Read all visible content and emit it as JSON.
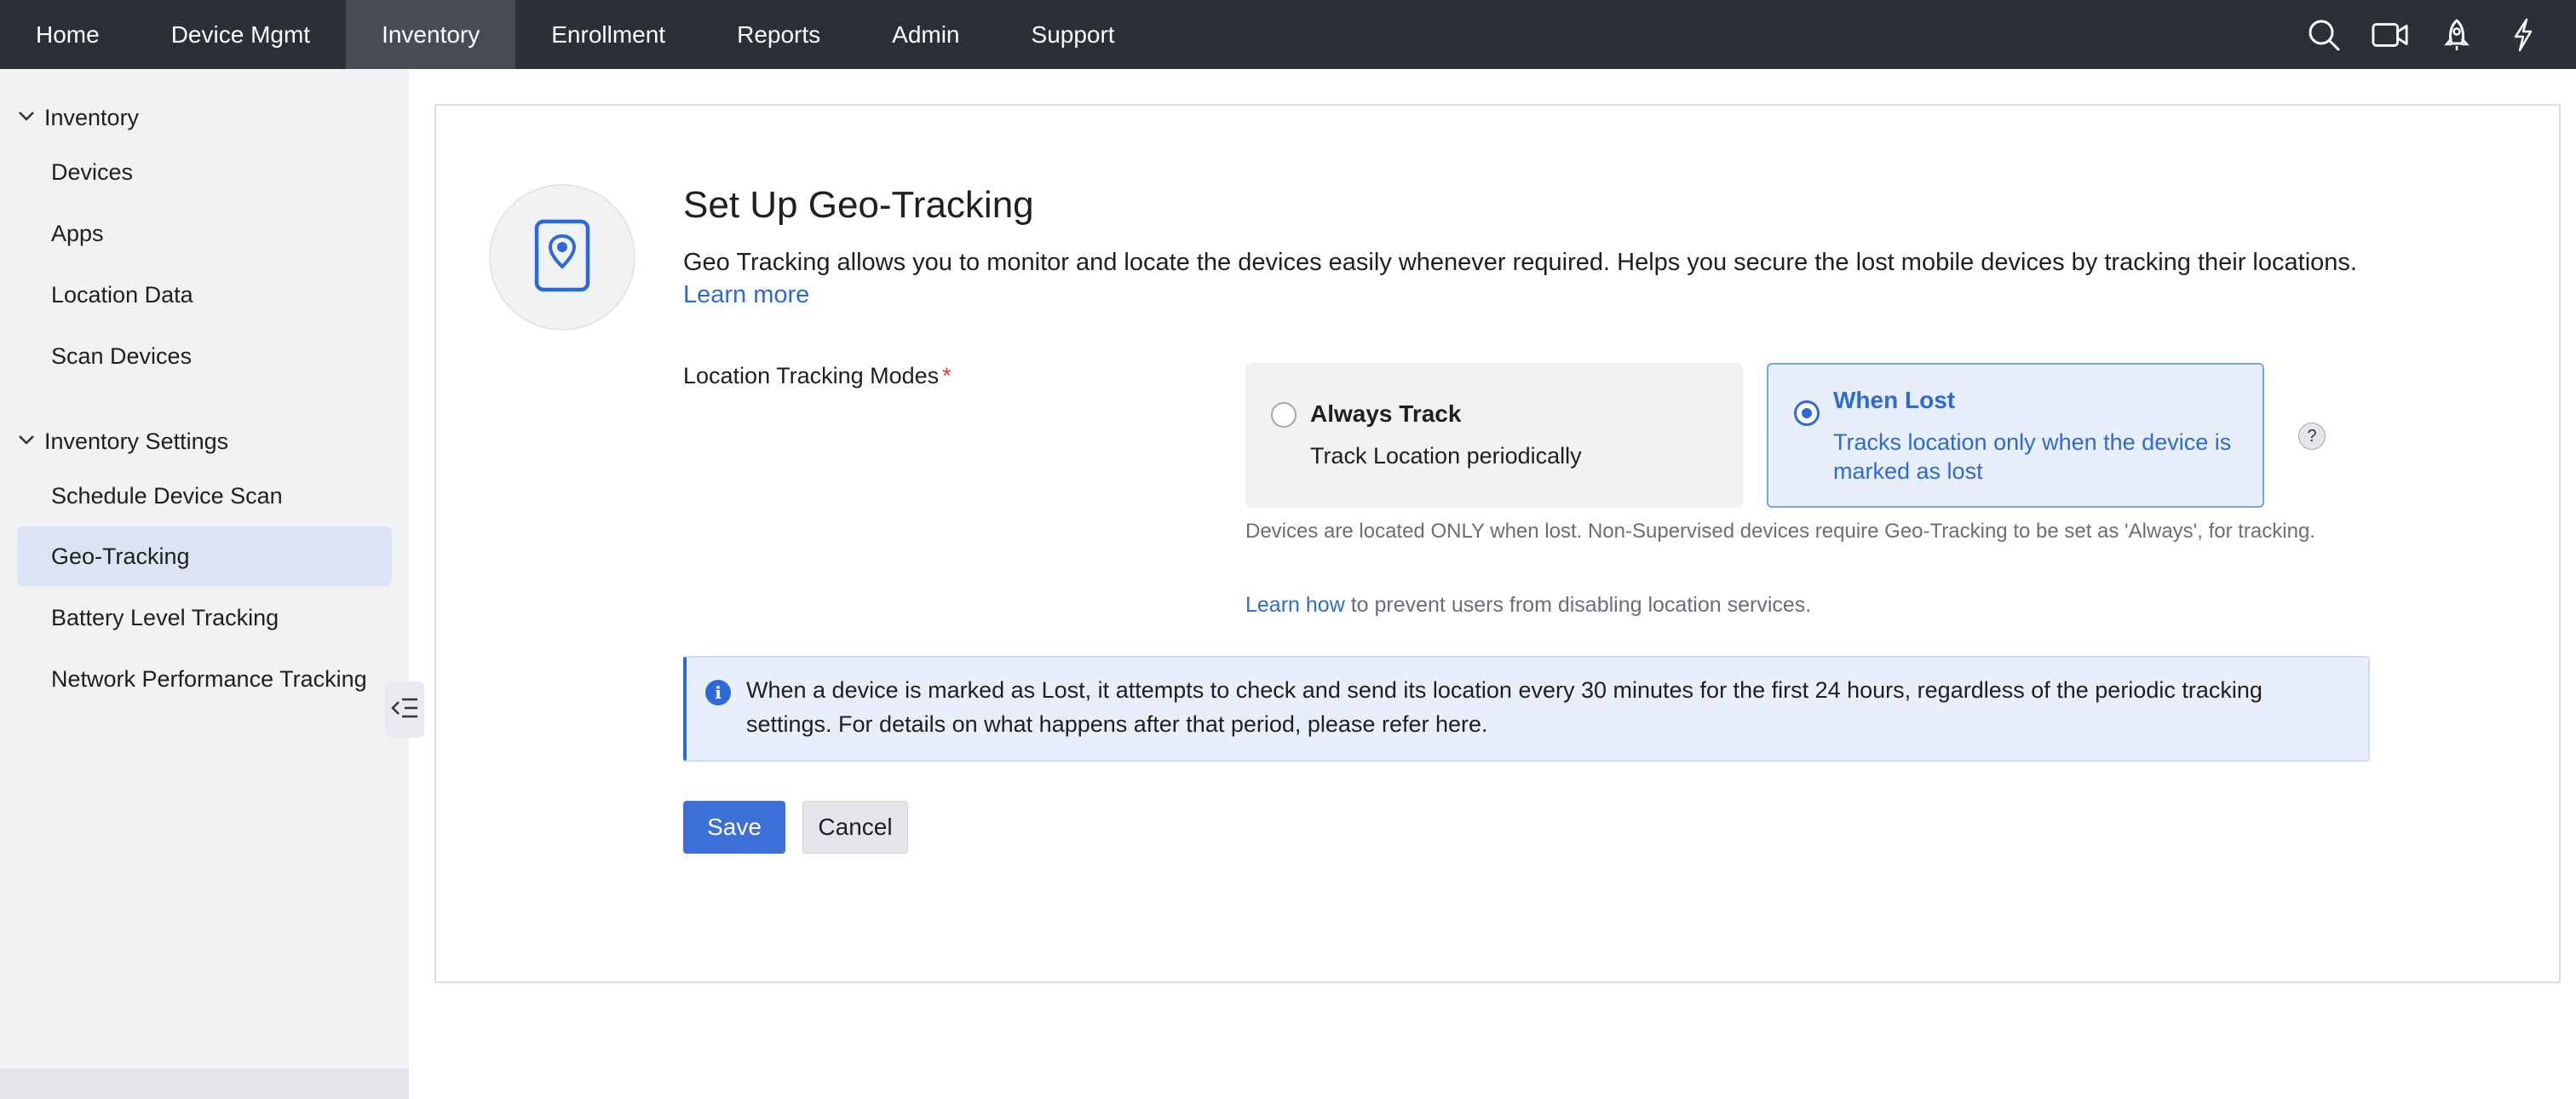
{
  "topnav": {
    "items": [
      {
        "label": "Home"
      },
      {
        "label": "Device Mgmt"
      },
      {
        "label": "Inventory"
      },
      {
        "label": "Enrollment"
      },
      {
        "label": "Reports"
      },
      {
        "label": "Admin"
      },
      {
        "label": "Support"
      }
    ],
    "active": "Inventory",
    "icons": [
      "search-icon",
      "video-icon",
      "rocket-icon",
      "lightning-icon"
    ]
  },
  "sidebar": {
    "group1": {
      "label": "Inventory",
      "items": [
        {
          "label": "Devices"
        },
        {
          "label": "Apps"
        },
        {
          "label": "Location Data"
        },
        {
          "label": "Scan Devices"
        }
      ]
    },
    "group2": {
      "label": "Inventory Settings",
      "items": [
        {
          "label": "Schedule Device Scan"
        },
        {
          "label": "Geo-Tracking"
        },
        {
          "label": "Battery Level Tracking"
        },
        {
          "label": "Network Performance Tracking"
        }
      ]
    },
    "active": "Geo-Tracking"
  },
  "main": {
    "title": "Set Up Geo-Tracking",
    "description": "Geo Tracking allows you to monitor and locate the devices easily whenever required. Helps you secure the lost mobile devices by tracking their locations.",
    "learn_more": "Learn more",
    "mode_label": "Location Tracking Modes",
    "required_mark": "*",
    "options": {
      "always": {
        "title": "Always Track",
        "subtitle": "Track Location periodically",
        "selected": false
      },
      "lost": {
        "title": "When Lost",
        "subtitle": "Tracks location only when the device is marked as lost",
        "selected": true
      }
    },
    "help_mark": "?",
    "note": "Devices are located ONLY when lost. Non-Supervised devices require Geo-Tracking to be set as 'Always', for tracking.",
    "learn_how": "Learn how",
    "learn_how_suffix": " to prevent users from disabling location services.",
    "info_icon": "i",
    "info_text": "When a device is marked as Lost, it attempts to check and send its location every 30 minutes for the first 24 hours, regardless of the periodic tracking settings. For details on what happens after that period, please refer here.",
    "save_label": "Save",
    "cancel_label": "Cancel"
  },
  "colors": {
    "accent": "#2d6ad9",
    "nav_bg": "#2b2f36",
    "sidebar_bg": "#f1f2f4",
    "selected_bg": "#dbe3f5"
  }
}
